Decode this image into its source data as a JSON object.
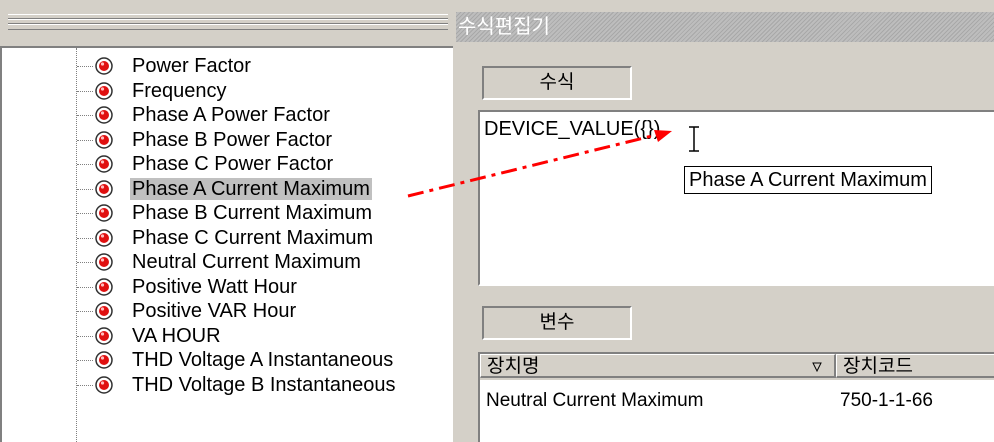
{
  "tree": {
    "items": [
      {
        "label": "Power Factor"
      },
      {
        "label": "Frequency"
      },
      {
        "label": "Phase A Power Factor"
      },
      {
        "label": "Phase B Power Factor"
      },
      {
        "label": "Phase C Power Factor"
      },
      {
        "label": "Phase A Current Maximum",
        "selected": true
      },
      {
        "label": "Phase B Current Maximum"
      },
      {
        "label": "Phase C Current Maximum"
      },
      {
        "label": "Neutral Current Maximum"
      },
      {
        "label": "Positive Watt Hour"
      },
      {
        "label": "Positive VAR Hour"
      },
      {
        "label": "VA HOUR"
      },
      {
        "label": "THD Voltage A Instantaneous"
      },
      {
        "label": "THD Voltage B Instantaneous"
      }
    ],
    "node_icon": "red-bullet-icon",
    "node_icon_color": "#e01010"
  },
  "editor": {
    "title": "수식편집기",
    "formula_section_label": "수식",
    "formula_text": "DEVICE_VALUE({})",
    "tooltip": "Phase A Current Maximum",
    "variable_section_label": "변수",
    "table": {
      "columns": [
        "장치명",
        "장치코드"
      ],
      "rows": [
        {
          "name": "Neutral Current Maximum",
          "code": "750-1-1-66"
        }
      ]
    }
  },
  "colors": {
    "drag_arrow": "#ff0000",
    "panel_bg": "#d4d0c8",
    "selection_bg": "#c0c0c0"
  }
}
